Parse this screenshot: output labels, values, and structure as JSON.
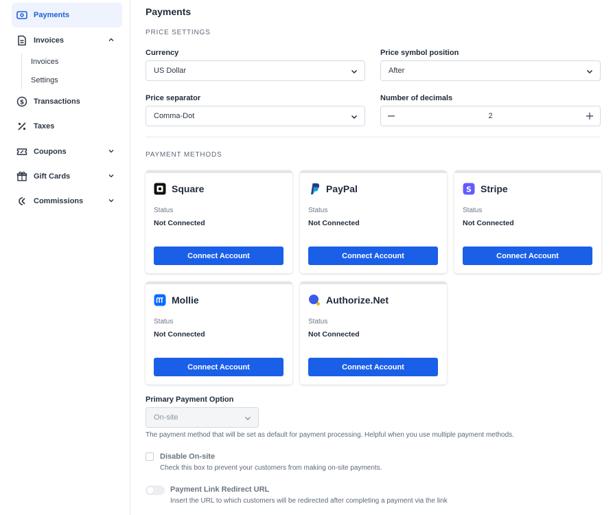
{
  "sidebar": {
    "items": [
      {
        "label": "Payments",
        "icon": "payments-icon",
        "active": true
      },
      {
        "label": "Invoices",
        "icon": "invoice-icon",
        "expanded": true
      },
      {
        "label": "Transactions",
        "icon": "dollar-circle-icon"
      },
      {
        "label": "Taxes",
        "icon": "percent-icon"
      },
      {
        "label": "Coupons",
        "icon": "coupon-icon"
      },
      {
        "label": "Gift Cards",
        "icon": "gift-icon"
      },
      {
        "label": "Commissions",
        "icon": "commissions-icon"
      }
    ],
    "invoices_sub": [
      "Invoices",
      "Settings"
    ]
  },
  "page": {
    "title": "Payments",
    "price_settings_label": "PRICE SETTINGS",
    "payment_methods_label": "PAYMENT METHODS"
  },
  "price_settings": {
    "currency": {
      "label": "Currency",
      "value": "US Dollar"
    },
    "symbol_position": {
      "label": "Price symbol position",
      "value": "After"
    },
    "separator": {
      "label": "Price separator",
      "value": "Comma-Dot"
    },
    "decimals": {
      "label": "Number of decimals",
      "value": "2"
    }
  },
  "payment_methods": [
    {
      "name": "Square",
      "status_label": "Status",
      "status": "Not Connected",
      "button": "Connect Account",
      "color": "#111111"
    },
    {
      "name": "PayPal",
      "status_label": "Status",
      "status": "Not Connected",
      "button": "Connect Account",
      "color": "#253b80"
    },
    {
      "name": "Stripe",
      "status_label": "Status",
      "status": "Not Connected",
      "button": "Connect Account",
      "color": "#635bff"
    },
    {
      "name": "Mollie",
      "status_label": "Status",
      "status": "Not Connected",
      "button": "Connect Account",
      "color": "#0a6cff"
    },
    {
      "name": "Authorize.Net",
      "status_label": "Status",
      "status": "Not Connected",
      "button": "Connect Account",
      "color": "#3d5be8"
    }
  ],
  "primary_option": {
    "label": "Primary Payment Option",
    "value": "On-site",
    "help": "The payment method that will be set as default for payment processing. Helpful when you use multiple payment methods."
  },
  "disable_onsite": {
    "label": "Disable On-site",
    "help": "Check this box to prevent your customers from making on-site payments.",
    "checked": false
  },
  "redirect_url": {
    "label": "Payment Link Redirect URL",
    "help": "Insert the URL to which customers will be redirected after completing a payment via the link",
    "enabled": false
  },
  "colors": {
    "accent": "#1a5fe8",
    "active_bg": "#eef3fd",
    "active_text": "#1f5fd6"
  }
}
